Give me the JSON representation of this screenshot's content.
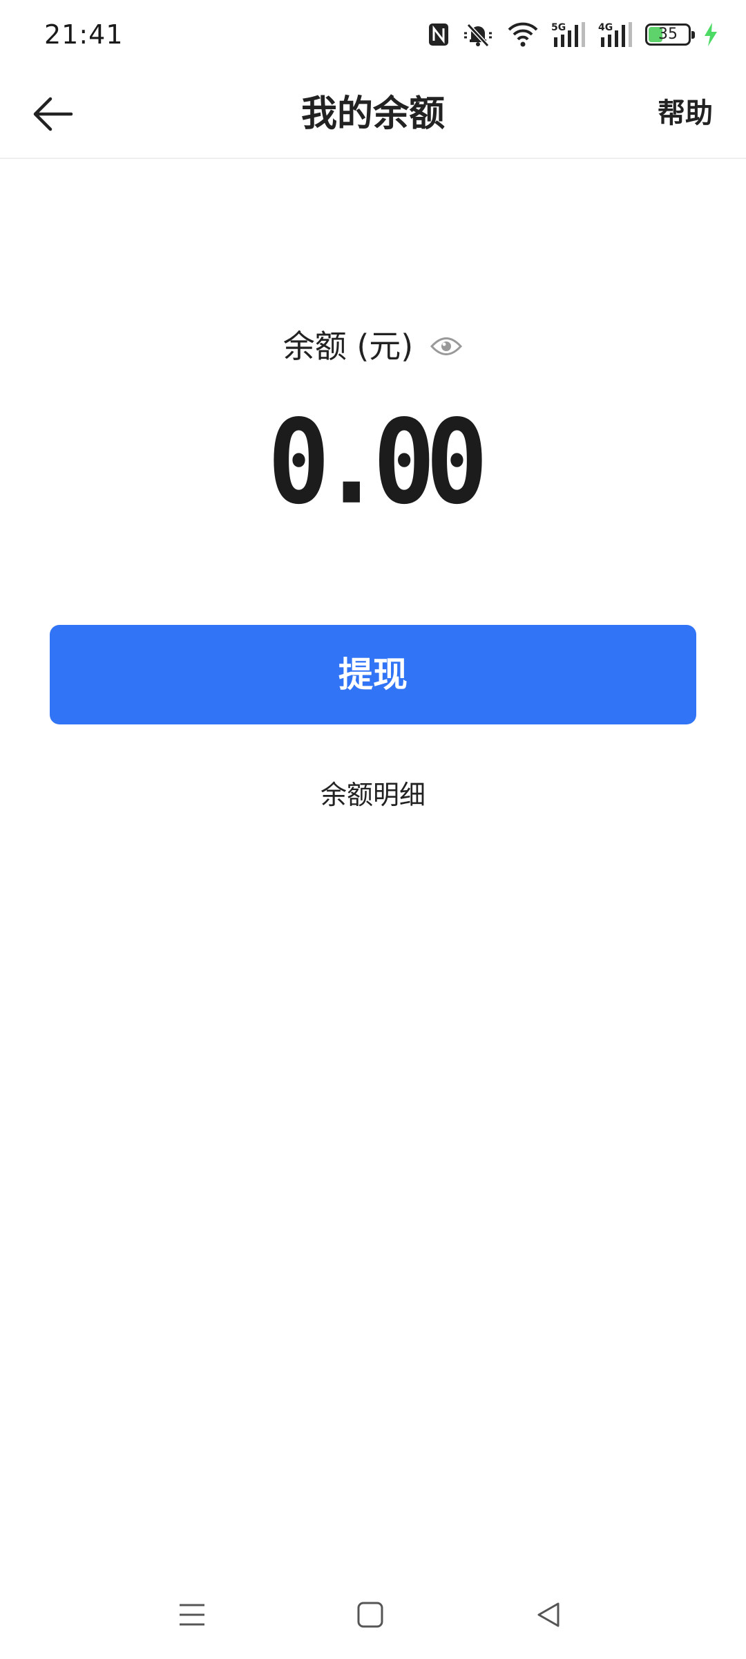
{
  "status_bar": {
    "time": "21:41",
    "battery_level": "35",
    "battery_fraction": 0.35,
    "icons": [
      "nfc-icon",
      "mute-icon",
      "wifi-icon",
      "signal-5g-icon",
      "signal-4g-icon",
      "battery-icon",
      "charging-icon"
    ],
    "signal_5g_label": "5G",
    "signal_4g_label": "4G",
    "charging_color": "#4cd964"
  },
  "header": {
    "title": "我的余额",
    "help_label": "帮助",
    "back_icon": "arrow-left-icon"
  },
  "balance": {
    "label": "余额 (元)",
    "amount": "0.00",
    "visibility_icon": "eye-icon"
  },
  "actions": {
    "withdraw_label": "提现",
    "withdraw_color": "#3274f6",
    "details_label": "余额明细"
  },
  "nav_bar": {
    "icons": [
      "menu-icon",
      "home-square-icon",
      "back-triangle-icon"
    ]
  }
}
